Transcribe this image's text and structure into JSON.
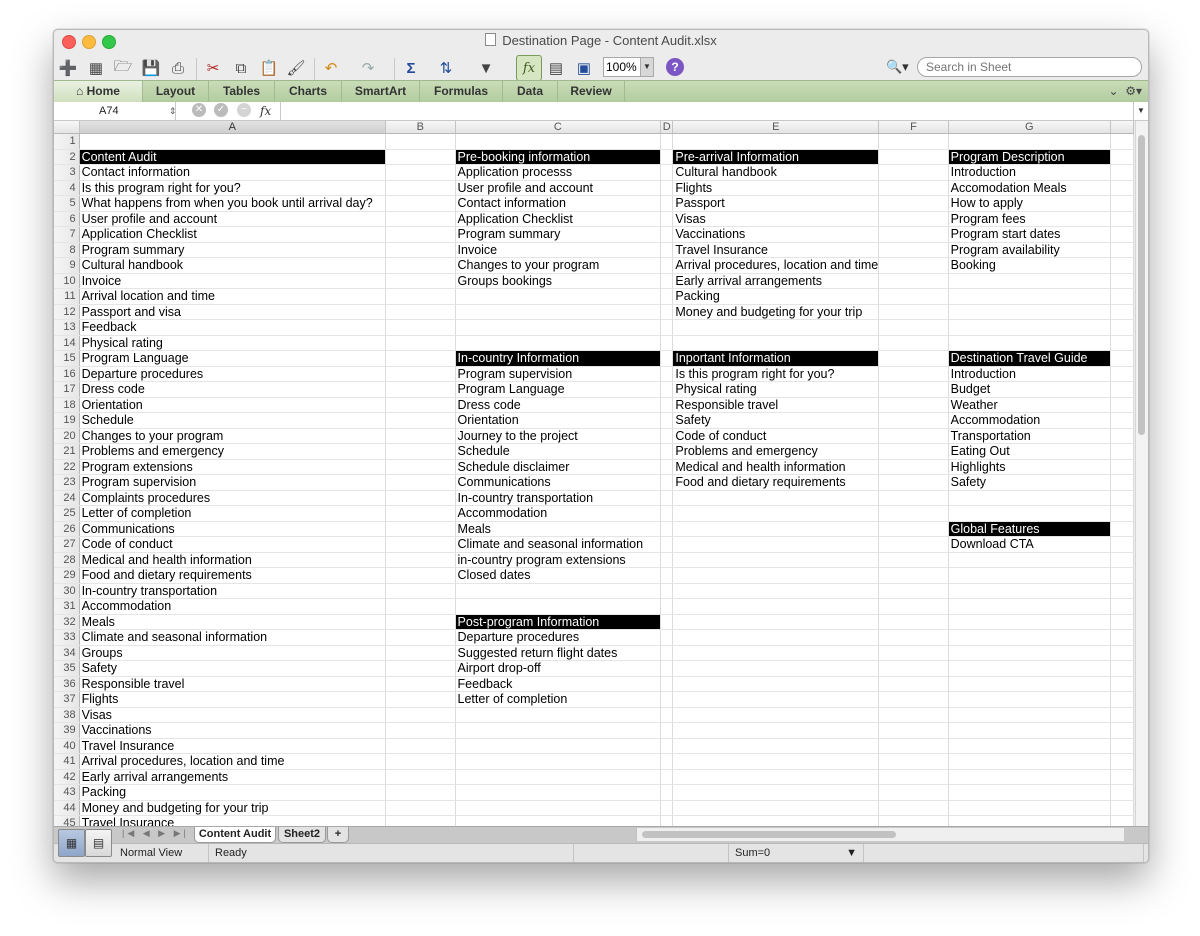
{
  "window": {
    "title": "Destination Page - Content Audit.xlsx"
  },
  "toolbar": {
    "zoom": "100%",
    "search_placeholder": "Search in Sheet",
    "icons": [
      "new-icon",
      "templates-icon",
      "open-icon",
      "save-icon",
      "print-icon",
      "cut-icon",
      "copy-icon",
      "paste-icon",
      "format-painter-icon",
      "undo-icon",
      "redo-icon",
      "autosum-icon",
      "sort-icon",
      "filter-icon",
      "formula-builder-icon",
      "media-browser-icon",
      "toolbox-icon",
      "help-icon"
    ]
  },
  "ribbon": {
    "tabs": [
      "Home",
      "Layout",
      "Tables",
      "Charts",
      "SmartArt",
      "Formulas",
      "Data",
      "Review"
    ]
  },
  "formula_bar": {
    "name_box": "A74",
    "fx": "fx",
    "formula": ""
  },
  "sheet": {
    "columns": [
      "A",
      "B",
      "C",
      "D",
      "E",
      "F",
      "G"
    ],
    "rows": [
      {
        "n": "1",
        "A": "",
        "C": "",
        "E": "",
        "G": ""
      },
      {
        "n": "2",
        "A": "Content Audit",
        "C": "Pre-booking information",
        "E": "Pre-arrival Information",
        "G": "Program Description"
      },
      {
        "n": "3",
        "A": "Contact information",
        "C": "Application processs",
        "E": "Cultural handbook",
        "G": "Introduction"
      },
      {
        "n": "4",
        "A": "Is this program right for you?",
        "C": "User profile and account",
        "E": "Flights",
        "G": "Accomodation Meals"
      },
      {
        "n": "5",
        "A": "What happens from when you book until arrival day?",
        "C": "Contact information",
        "E": "Passport",
        "G": "How to apply"
      },
      {
        "n": "6",
        "A": "User profile and account",
        "C": "Application Checklist",
        "E": "Visas",
        "G": "Program fees"
      },
      {
        "n": "7",
        "A": "Application Checklist",
        "C": "Program summary",
        "E": "Vaccinations",
        "G": "Program start dates"
      },
      {
        "n": "8",
        "A": "Program summary",
        "C": "Invoice",
        "E": "Travel Insurance",
        "G": "Program availability"
      },
      {
        "n": "9",
        "A": "Cultural handbook",
        "C": "Changes to your program",
        "E": "Arrival procedures, location and time",
        "G": "Booking"
      },
      {
        "n": "10",
        "A": "Invoice",
        "C": "Groups bookings",
        "E": "Early arrival arrangements",
        "G": ""
      },
      {
        "n": "11",
        "A": "Arrival location and time",
        "C": "",
        "E": "Packing",
        "G": ""
      },
      {
        "n": "12",
        "A": "Passport and visa",
        "C": "",
        "E": "Money and budgeting for your trip",
        "G": ""
      },
      {
        "n": "13",
        "A": "Feedback",
        "C": "",
        "E": "",
        "G": ""
      },
      {
        "n": "14",
        "A": "Physical rating",
        "C": "",
        "E": "",
        "G": ""
      },
      {
        "n": "15",
        "A": "Program Language",
        "C": "In-country Information",
        "E": "Inportant Information",
        "G": "Destination Travel Guide"
      },
      {
        "n": "16",
        "A": "Departure procedures",
        "C": "Program supervision",
        "E": "Is this program right for you?",
        "G": "Introduction"
      },
      {
        "n": "17",
        "A": "Dress code",
        "C": "Program Language",
        "E": "Physical rating",
        "G": "Budget"
      },
      {
        "n": "18",
        "A": "Orientation",
        "C": "Dress code",
        "E": "Responsible travel",
        "G": "Weather"
      },
      {
        "n": "19",
        "A": "Schedule",
        "C": "Orientation",
        "E": "Safety",
        "G": "Accommodation"
      },
      {
        "n": "20",
        "A": "Changes to your program",
        "C": "Journey to the project",
        "E": "Code of conduct",
        "G": "Transportation"
      },
      {
        "n": "21",
        "A": "Problems and emergency",
        "C": "Schedule",
        "E": "Problems and emergency",
        "G": "Eating Out"
      },
      {
        "n": "22",
        "A": "Program extensions",
        "C": "Schedule disclaimer",
        "E": "Medical and health information",
        "G": "Highlights"
      },
      {
        "n": "23",
        "A": "Program supervision",
        "C": "Communications",
        "E": "Food and dietary requirements",
        "G": "Safety"
      },
      {
        "n": "24",
        "A": "Complaints procedures",
        "C": "In-country transportation",
        "E": "",
        "G": ""
      },
      {
        "n": "25",
        "A": "Letter of completion",
        "C": "Accommodation",
        "E": "",
        "G": ""
      },
      {
        "n": "26",
        "A": "Communications",
        "C": "Meals",
        "E": "",
        "G": "Global Features"
      },
      {
        "n": "27",
        "A": "Code of conduct",
        "C": "Climate and seasonal information",
        "E": "",
        "G": "Download CTA"
      },
      {
        "n": "28",
        "A": "Medical and health information",
        "C": "in-country program extensions",
        "E": "",
        "G": ""
      },
      {
        "n": "29",
        "A": "Food and dietary requirements",
        "C": "Closed dates",
        "E": "",
        "G": ""
      },
      {
        "n": "30",
        "A": "In-country transportation",
        "C": "",
        "E": "",
        "G": ""
      },
      {
        "n": "31",
        "A": "Accommodation",
        "C": "",
        "E": "",
        "G": ""
      },
      {
        "n": "32",
        "A": "Meals",
        "C": "Post-program Information",
        "E": "",
        "G": ""
      },
      {
        "n": "33",
        "A": "Climate and seasonal information",
        "C": "Departure procedures",
        "E": "",
        "G": ""
      },
      {
        "n": "34",
        "A": "Groups",
        "C": "Suggested return flight dates",
        "E": "",
        "G": ""
      },
      {
        "n": "35",
        "A": "Safety",
        "C": "Airport drop-off",
        "E": "",
        "G": ""
      },
      {
        "n": "36",
        "A": "Responsible travel",
        "C": "Feedback",
        "E": "",
        "G": ""
      },
      {
        "n": "37",
        "A": "Flights",
        "C": "Letter of completion",
        "E": "",
        "G": ""
      },
      {
        "n": "38",
        "A": "Visas",
        "C": "",
        "E": "",
        "G": ""
      },
      {
        "n": "39",
        "A": "Vaccinations",
        "C": "",
        "E": "",
        "G": ""
      },
      {
        "n": "40",
        "A": "Travel Insurance",
        "C": "",
        "E": "",
        "G": ""
      },
      {
        "n": "41",
        "A": "Arrival procedures, location and time",
        "C": "",
        "E": "",
        "G": ""
      },
      {
        "n": "42",
        "A": "Early arrival arrangements",
        "C": "",
        "E": "",
        "G": ""
      },
      {
        "n": "43",
        "A": "Packing",
        "C": "",
        "E": "",
        "G": ""
      },
      {
        "n": "44",
        "A": "Money and budgeting for your trip",
        "C": "",
        "E": "",
        "G": ""
      },
      {
        "n": "45",
        "A": "Travel Insurance",
        "C": "",
        "E": "",
        "G": ""
      }
    ],
    "header_cells": [
      "A2",
      "C2",
      "E2",
      "G2",
      "C15",
      "E15",
      "G15",
      "G26",
      "C32"
    ],
    "header_fill": "#000000",
    "header_text_color": "#ffffff"
  },
  "sheet_tabs": {
    "tabs": [
      "Content Audit",
      "Sheet2"
    ],
    "active": "Content Audit",
    "add_label": "+"
  },
  "status_bar": {
    "view": "Normal View",
    "state": "Ready",
    "sum": "Sum=0"
  },
  "colors": {
    "ribbon": "#b8d0a6",
    "accent_help": "#7b56c4"
  }
}
